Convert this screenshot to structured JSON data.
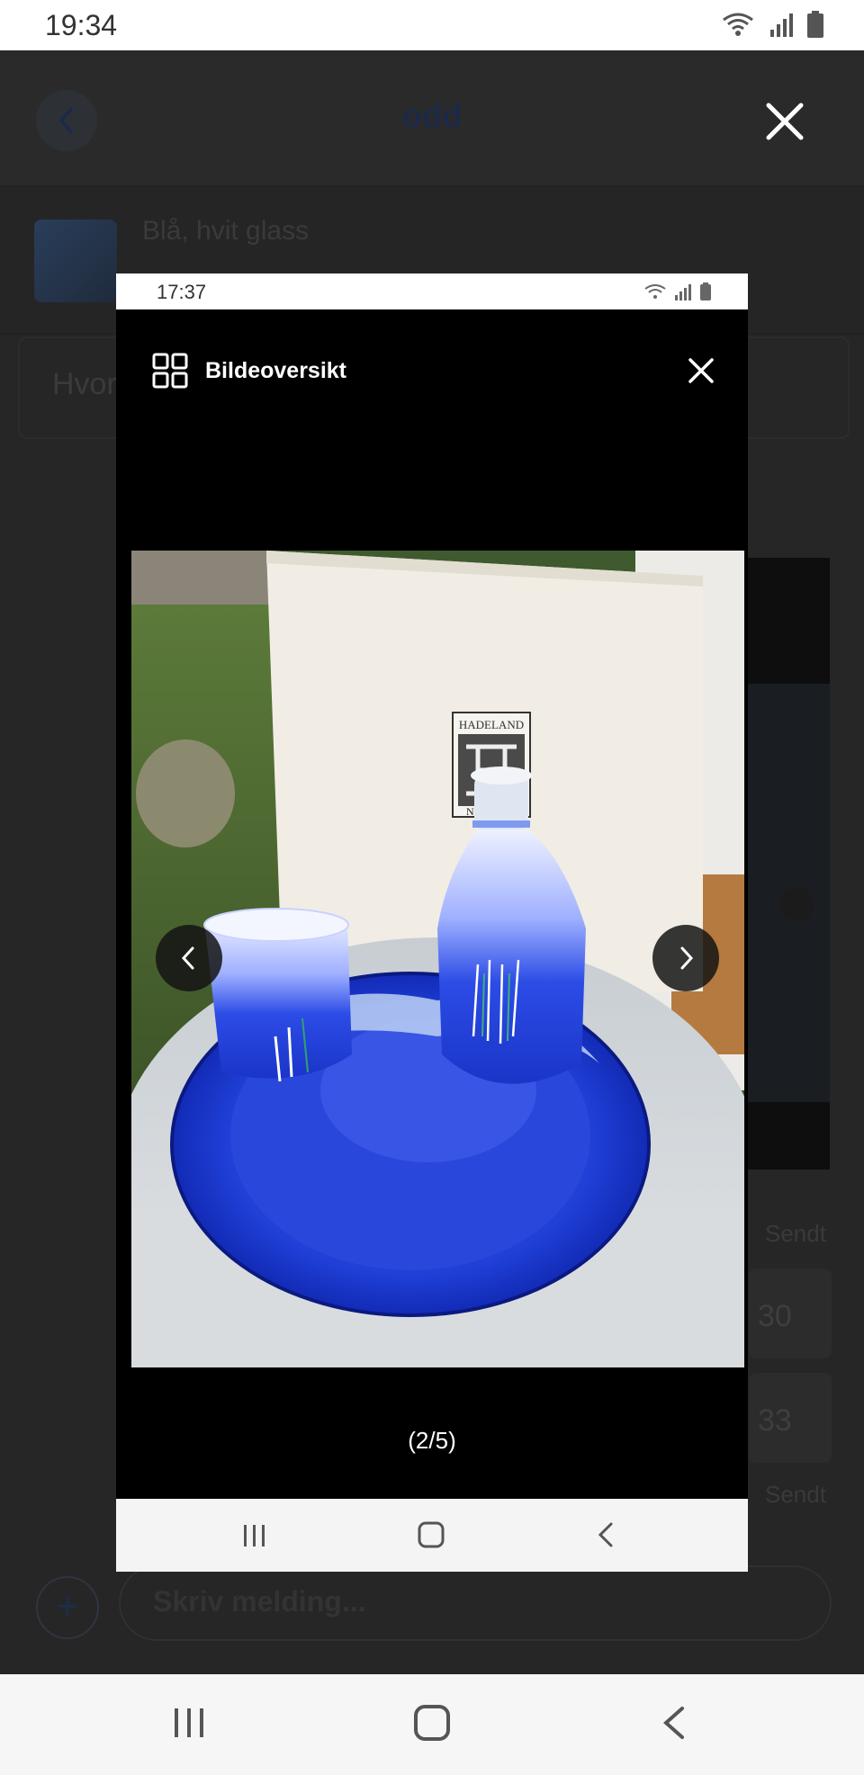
{
  "status_bar": {
    "time": "19:34"
  },
  "chat": {
    "title": "odd",
    "listing_title": "Blå, hvit glass",
    "input_preview": "Hvor",
    "sent_label_1": "Sendt",
    "sent_label_2": "Sendt",
    "number_1": "30",
    "number_2": "33",
    "compose_placeholder": "Skriv melding..."
  },
  "screenshot": {
    "status_time": "17:37",
    "gallery_label": "Bildeoversikt",
    "counter": "(2/5)",
    "photo_box_brand": "HADELAND",
    "photo_box_text": "NOR"
  },
  "colors": {
    "accent": "#1c2a48",
    "glass_blue": "#1f3fd6",
    "overlay_black": "#000000"
  },
  "icons": {
    "close": "close-icon",
    "gallery": "grid-icon",
    "prev": "chevron-left-icon",
    "next": "chevron-right-icon"
  }
}
